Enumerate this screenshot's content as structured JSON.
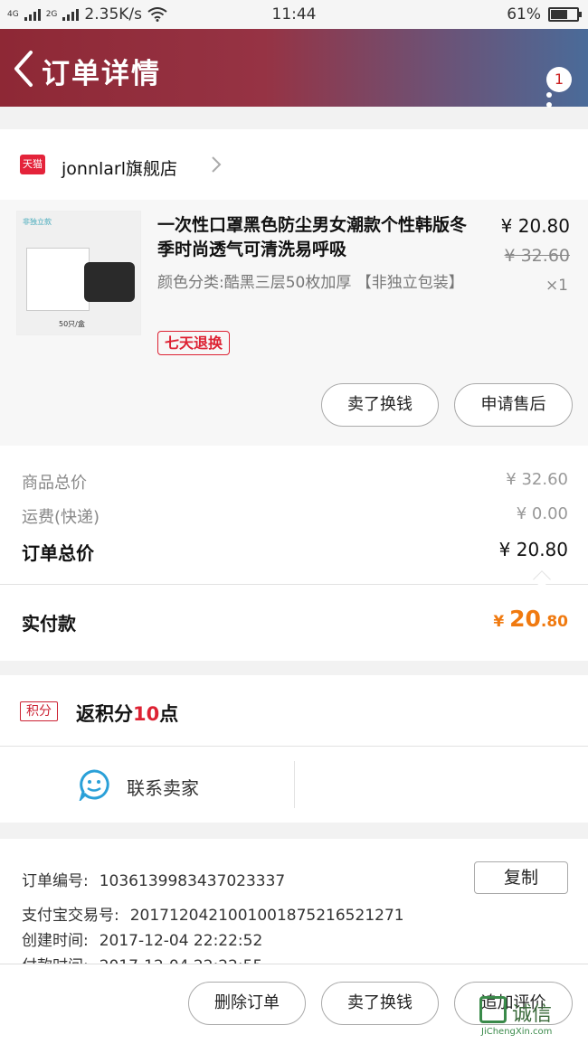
{
  "status": {
    "sig1": "4G",
    "sig2": "2G",
    "speed": "2.35K/s",
    "time": "11:44",
    "battery": "61%"
  },
  "header": {
    "title": "订单详情",
    "badge": "1"
  },
  "shop": {
    "logo": "天猫",
    "name": "jonnlarl旗舰店"
  },
  "product": {
    "thumb_label": "非独立款",
    "thumb_foot": "50只/盒",
    "title": "一次性口罩黑色防尘男女潮款个性韩版冬季时尚透气可清洗易呼吸",
    "spec": "颜色分类:酷黑三层50枚加厚 【非独立包装】",
    "price": "¥ 20.80",
    "old_price": "¥ 32.60",
    "qty": "×1",
    "tag": "七天退换",
    "btn_sell": "卖了换钱",
    "btn_aftersale": "申请售后"
  },
  "summary": {
    "goods_label": "商品总价",
    "goods_value": "¥ 32.60",
    "ship_label": "运费(快递)",
    "ship_value": "¥ 0.00",
    "total_label": "订单总价",
    "total_value": "¥ 20.80",
    "paid_label": "实付款",
    "paid_sym": "¥ ",
    "paid_int": "20",
    "paid_dec": ".80"
  },
  "points": {
    "tag": "积分",
    "pre": "返积分",
    "num": "10",
    "post": "点"
  },
  "contact": {
    "label": "联系卖家"
  },
  "order": {
    "no_label": "订单编号:",
    "no_value": "1036139983437023337",
    "alipay_label": "支付宝交易号:",
    "alipay_value": "2017120421001001875216521271",
    "created_label": "创建时间:",
    "created_value": "2017-12-04 22:22:52",
    "paid_label": "付款时间:",
    "paid_value": "2017-12-04 22:22:55",
    "copy": "复制"
  },
  "bottom": {
    "delete": "删除订单",
    "sell": "卖了换钱",
    "review": "追加评价"
  },
  "watermark": {
    "text": "诚信",
    "sub": "JiChengXin.com"
  },
  "colors": {
    "header_start": "#8e2835",
    "header_end": "#4a6b99",
    "accent_red": "#d22233",
    "pay_orange": "#f07a10"
  }
}
